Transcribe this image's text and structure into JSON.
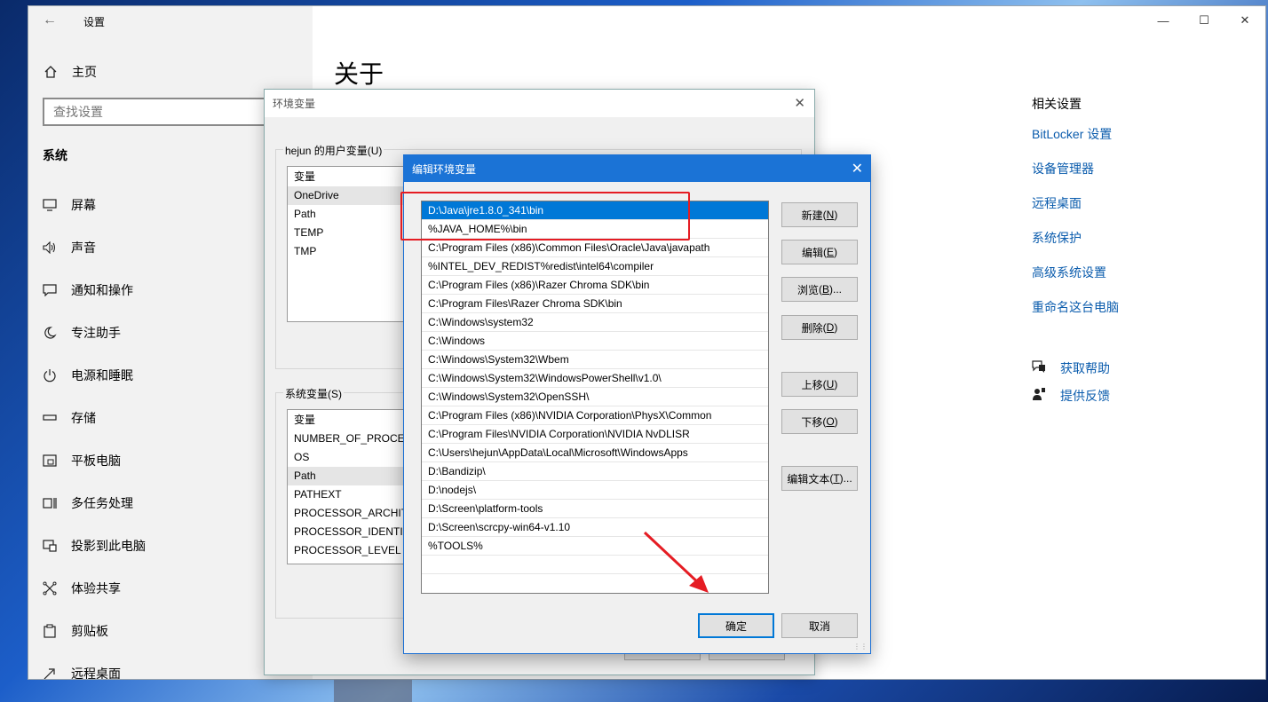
{
  "settings": {
    "title": "设置",
    "home": "主页",
    "search_placeholder": "查找设置",
    "section": "系统",
    "nav": [
      {
        "label": "屏幕",
        "icon": "monitor-icon"
      },
      {
        "label": "声音",
        "icon": "speaker-icon"
      },
      {
        "label": "通知和操作",
        "icon": "notification-icon"
      },
      {
        "label": "专注助手",
        "icon": "moon-icon"
      },
      {
        "label": "电源和睡眠",
        "icon": "power-icon"
      },
      {
        "label": "存储",
        "icon": "storage-icon"
      },
      {
        "label": "平板电脑",
        "icon": "tablet-icon"
      },
      {
        "label": "多任务处理",
        "icon": "multitask-icon"
      },
      {
        "label": "投影到此电脑",
        "icon": "project-icon"
      },
      {
        "label": "体验共享",
        "icon": "share-icon"
      },
      {
        "label": "剪贴板",
        "icon": "clipboard-icon"
      },
      {
        "label": "远程桌面",
        "icon": "remote-icon"
      }
    ],
    "page_title": "关于",
    "related_heading": "相关设置",
    "related_links": [
      "BitLocker 设置",
      "设备管理器",
      "远程桌面",
      "系统保护",
      "高级系统设置",
      "重命名这台电脑"
    ],
    "help": [
      {
        "label": "获取帮助",
        "icon": "help-icon"
      },
      {
        "label": "提供反馈",
        "icon": "feedback-icon"
      }
    ]
  },
  "env_dialog": {
    "title": "环境变量",
    "user_group": "hejun 的用户变量(U)",
    "user_header": "变量",
    "user_vars": [
      "OneDrive",
      "Path",
      "TEMP",
      "TMP"
    ],
    "system_group": "系统变量(S)",
    "system_header": "变量",
    "system_vars": [
      "NUMBER_OF_PROCES",
      "OS",
      "Path",
      "PATHEXT",
      "PROCESSOR_ARCHIT",
      "PROCESSOR_IDENTIF",
      "PROCESSOR_LEVEL"
    ]
  },
  "edit_dialog": {
    "title": "编辑环境变量",
    "paths": [
      "D:\\Java\\jre1.8.0_341\\bin",
      "%JAVA_HOME%\\bin",
      "C:\\Program Files (x86)\\Common Files\\Oracle\\Java\\javapath",
      "%INTEL_DEV_REDIST%redist\\intel64\\compiler",
      "C:\\Program Files (x86)\\Razer Chroma SDK\\bin",
      "C:\\Program Files\\Razer Chroma SDK\\bin",
      "C:\\Windows\\system32",
      "C:\\Windows",
      "C:\\Windows\\System32\\Wbem",
      "C:\\Windows\\System32\\WindowsPowerShell\\v1.0\\",
      "C:\\Windows\\System32\\OpenSSH\\",
      "C:\\Program Files (x86)\\NVIDIA Corporation\\PhysX\\Common",
      "C:\\Program Files\\NVIDIA Corporation\\NVIDIA NvDLISR",
      "C:\\Users\\hejun\\AppData\\Local\\Microsoft\\WindowsApps",
      "D:\\Bandizip\\",
      "D:\\nodejs\\",
      "D:\\Screen\\platform-tools",
      "D:\\Screen\\scrcpy-win64-v1.10",
      "%TOOLS%",
      ""
    ],
    "buttons": {
      "new": "新建",
      "new_key": "N",
      "edit": "编辑",
      "edit_key": "E",
      "browse": "浏览",
      "browse_key": "B",
      "delete": "删除",
      "delete_key": "D",
      "up": "上移",
      "up_key": "U",
      "down": "下移",
      "down_key": "O",
      "edit_text": "编辑文本",
      "edit_text_key": "T",
      "ok": "确定",
      "cancel": "取消"
    }
  },
  "colors": {
    "accent": "#0078d7",
    "title_blue": "#1b73d6",
    "link": "#0b5cad",
    "annotation_red": "#e51c23"
  }
}
